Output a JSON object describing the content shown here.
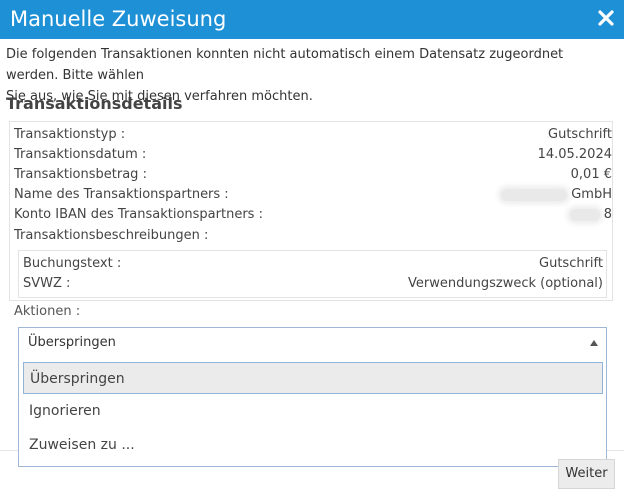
{
  "dialog": {
    "title": "Manuelle Zuweisung",
    "intro_line1": "Die folgenden Transaktionen konnten nicht automatisch einem Datensatz zugeordnet werden. Bitte wählen",
    "intro_line2": "Sie aus, wie Sie mit diesen verfahren möchten.",
    "section_title": "Transaktionsdetails",
    "header_color": "#1e90d6"
  },
  "details": {
    "type_label": "Transaktionstyp :",
    "type_value": "Gutschrift",
    "date_label": "Transaktionsdatum :",
    "date_value": "14.05.2024",
    "amount_label": "Transaktionsbetrag :",
    "amount_value": "0,01 €",
    "partner_label": "Name des Transaktionspartners :",
    "partner_value_visible": "GmbH",
    "iban_label": "Konto IBAN des Transaktionspartners :",
    "iban_value_visible": "8",
    "descriptions_label": "Transaktionsbeschreibungen :"
  },
  "descriptions": {
    "booking_label": "Buchungstext :",
    "booking_value": "Gutschrift",
    "svwz_label": "SVWZ :",
    "svwz_value": "Verwendungszweck (optional)"
  },
  "actions": {
    "label": "Aktionen :",
    "selected": "Überspringen",
    "options": [
      "Überspringen",
      "Ignorieren",
      "Zuweisen zu ..."
    ]
  },
  "footer": {
    "next_button": "Weiter"
  }
}
